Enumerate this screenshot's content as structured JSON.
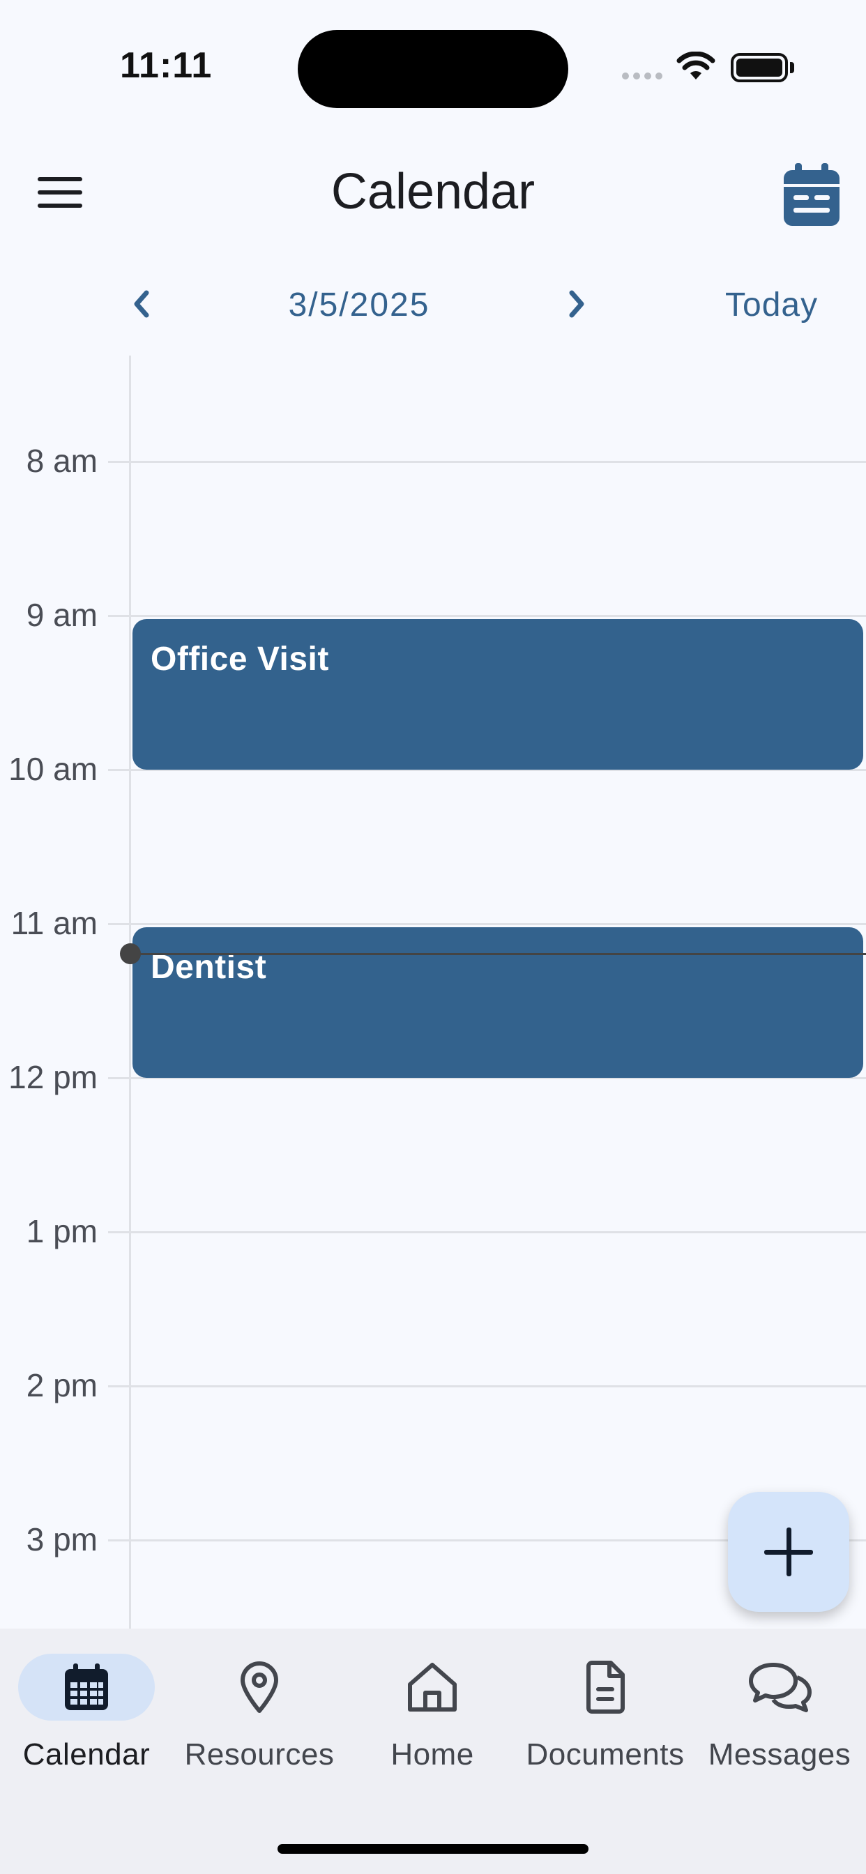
{
  "status_bar": {
    "time": "11:11"
  },
  "app_bar": {
    "title": "Calendar",
    "menu_icon": "hamburger-menu-icon",
    "calendar_icon": "calendar-icon"
  },
  "date_nav": {
    "date": "3/5/2025",
    "today_label": "Today"
  },
  "timeline": {
    "hours": [
      "8 am",
      "9 am",
      "10 am",
      "11 am",
      "12 pm",
      "1 pm",
      "2 pm",
      "3 pm"
    ]
  },
  "events": [
    {
      "title": "Office Visit"
    },
    {
      "title": "Dentist"
    }
  ],
  "fab": {
    "icon": "plus-icon"
  },
  "bottom_nav": {
    "items": [
      {
        "label": "Calendar",
        "icon": "calendar-icon",
        "active": true
      },
      {
        "label": "Resources",
        "icon": "map-pin-icon",
        "active": false
      },
      {
        "label": "Home",
        "icon": "home-icon",
        "active": false
      },
      {
        "label": "Documents",
        "icon": "document-icon",
        "active": false
      },
      {
        "label": "Messages",
        "icon": "chat-bubbles-icon",
        "active": false
      }
    ]
  },
  "colors": {
    "accent": "#34628e",
    "event_fill": "#33628d",
    "fab_bg": "#d4e4fa",
    "background": "#f7f9fe"
  }
}
